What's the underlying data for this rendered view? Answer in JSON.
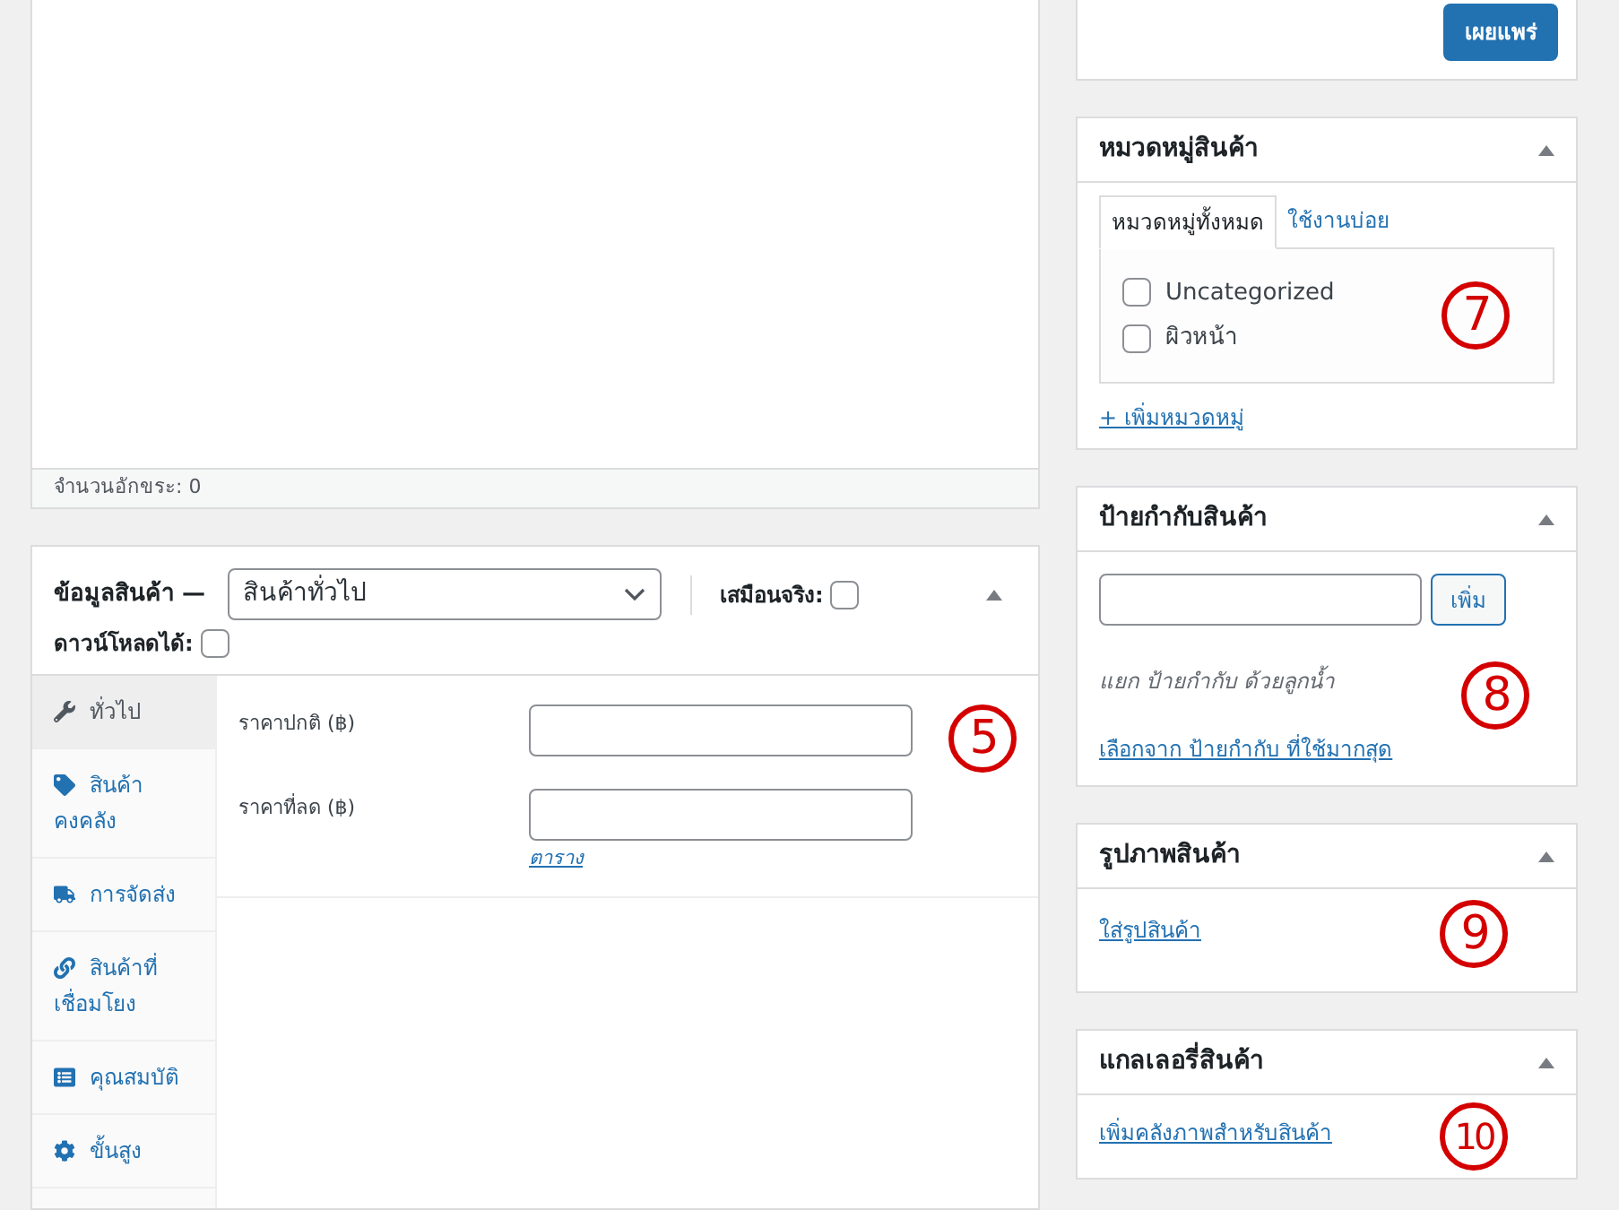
{
  "editor": {
    "status": "จำนวนอักขระ: 0"
  },
  "product_data": {
    "title": "ข้อมูลสินค้า —",
    "type_select": {
      "value": "สินค้าทั่วไป"
    },
    "options": [
      {
        "label": "เสมือนจริง:",
        "checked": false
      },
      {
        "label": "ดาวน์โหลดได้:",
        "checked": false
      }
    ],
    "tabs": [
      {
        "label": "ทั่วไป",
        "selected": true
      },
      {
        "label": "สินค้าคงคลัง",
        "selected": false
      },
      {
        "label": "การจัดส่ง",
        "selected": false
      },
      {
        "label": "สินค้าที่เชื่อมโยง",
        "selected": false
      },
      {
        "label": "คุณสมบัติ",
        "selected": false
      },
      {
        "label": "ขั้นสูง",
        "selected": false
      }
    ],
    "fields": [
      {
        "label": "ราคาปกติ (฿)"
      },
      {
        "label": "ราคาที่ลด (฿)"
      }
    ],
    "schedule_link": "ตาราง",
    "annotation": "5"
  },
  "publish": {
    "button": "เผยแพร่"
  },
  "categories": {
    "title": "หมวดหมู่สินค้า",
    "tabs": [
      {
        "label": "หมวดหมู่ทั้งหมด",
        "selected": true
      },
      {
        "label": "ใช้งานบ่อย",
        "selected": false
      }
    ],
    "items": [
      {
        "label": "Uncategorized",
        "checked": false
      },
      {
        "label": "ผิวหน้า",
        "checked": false
      }
    ],
    "add_link": "+ เพิ่มหมวดหมู่",
    "annotation": "7"
  },
  "tags": {
    "title": "ป้ายกำกับสินค้า",
    "add_button": "เพิ่ม",
    "hint": "แยก ป้ายกำกับ ด้วยลูกน้ำ",
    "choose_link": "เลือกจาก ป้ายกำกับ ที่ใช้มากสุด",
    "annotation": "8"
  },
  "image": {
    "title": "รูปภาพสินค้า",
    "link": "ใส่รูปสินค้า",
    "annotation": "9"
  },
  "gallery": {
    "title": "แกลเลอรี่สินค้า",
    "link": "เพิ่มคลังภาพสำหรับสินค้า",
    "annotation": "10"
  }
}
